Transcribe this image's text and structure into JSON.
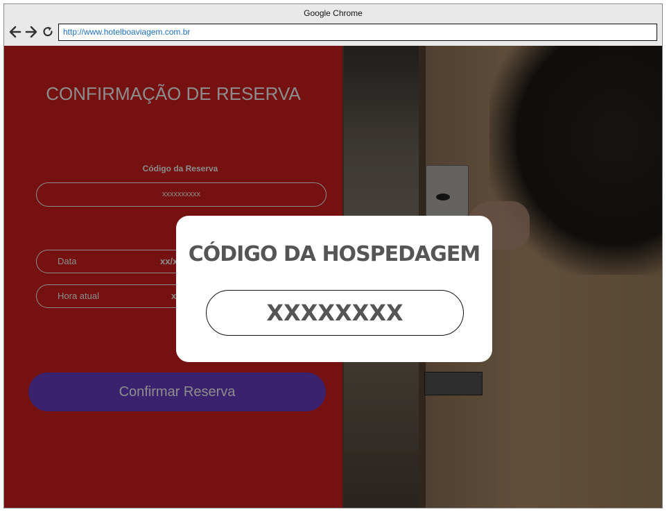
{
  "browser": {
    "window_title": "Google Chrome",
    "url": "http://www.hotelboaviagem.com.br"
  },
  "form": {
    "title": "CONFIRMAÇÃO DE RESERVA",
    "code_label": "Código da Reserva",
    "code_placeholder": "xxxxxxxxxx",
    "date_label": "Data",
    "date_value": "xx/x",
    "time_label": "Hora atual",
    "time_value": "x",
    "confirm_label": "Confirmar Reserva"
  },
  "modal": {
    "title": "CÓDIGO DA HOSPEDAGEM",
    "code": "XXXXXXXX"
  },
  "colors": {
    "panel_red": "#d52020",
    "button_purple": "#6b3fc8",
    "link_blue": "#1d6fb8"
  },
  "icons": [
    "back-arrow-icon",
    "forward-arrow-icon",
    "reload-icon"
  ]
}
